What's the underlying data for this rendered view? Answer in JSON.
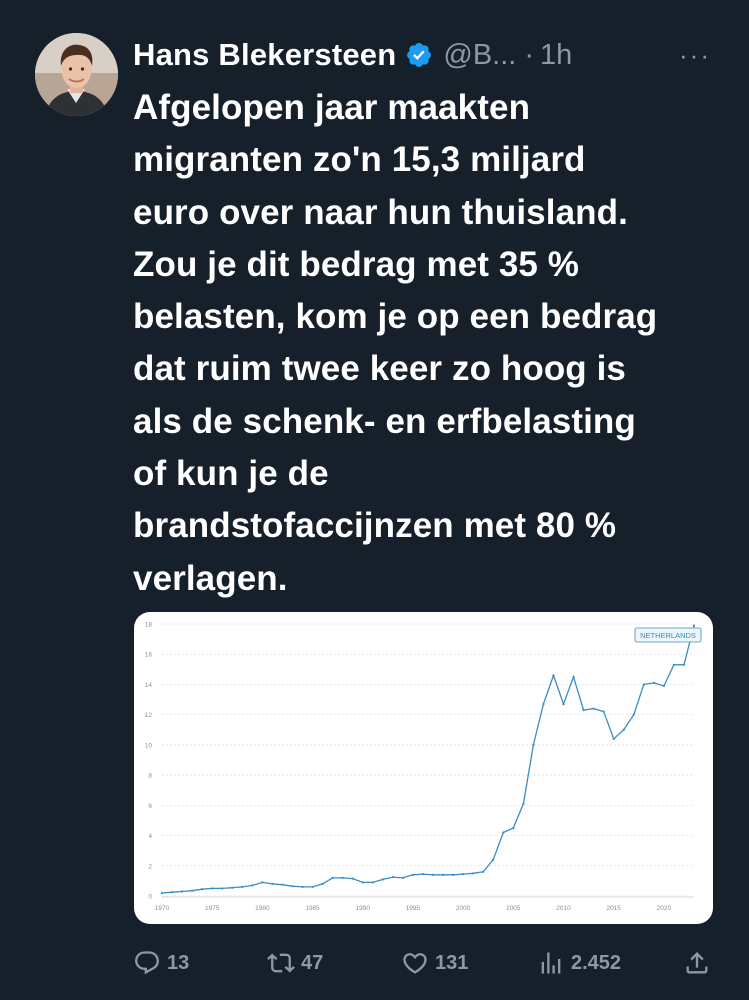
{
  "tweet": {
    "display_name": "Hans Blekersteen",
    "handle": "@B...",
    "separator": "·",
    "time": "1h",
    "more_glyph": "···",
    "text": "Afgelopen jaar maakten\nmigranten zo'n 15,3 miljard\neuro over naar hun thuisland.\nZou je dit bedrag met 35 %\nbelasten, kom je op een bedrag\ndat ruim twee keer zo hoog is\nals de schenk- en erfbelasting\nof kun je de\nbrandstofaccijnzen met 80 %\nverlagen."
  },
  "actions": {
    "replies": "13",
    "retweets": "47",
    "likes": "131",
    "views": "2.452"
  },
  "icons": {
    "reply": "speech-bubble",
    "retweet": "retweet-arrows",
    "like": "heart",
    "views": "bar-chart",
    "share": "share-upload",
    "verified": "verified-badge"
  },
  "colors": {
    "background": "#15202b",
    "secondary_text": "#8b98a5",
    "verified_blue": "#1d9bf0",
    "line": "#3a8dc4"
  },
  "chart_data": {
    "type": "line",
    "legend": "NETHERLANDS",
    "legend_position": "top-right",
    "grid": true,
    "xlim": [
      1970,
      2023
    ],
    "ylim": [
      0,
      18
    ],
    "x_ticks": [
      "1970",
      "1975",
      "1980",
      "1985",
      "1990",
      "1995",
      "2000",
      "2005",
      "2010",
      "2015",
      "2020"
    ],
    "y_ticks": [
      "0",
      "2",
      "4",
      "6",
      "8",
      "10",
      "12",
      "14",
      "16",
      "18"
    ],
    "series": [
      {
        "name": "NETHERLANDS",
        "x": [
          1970,
          1971,
          1972,
          1973,
          1974,
          1975,
          1976,
          1977,
          1978,
          1979,
          1980,
          1981,
          1982,
          1983,
          1984,
          1985,
          1986,
          1987,
          1988,
          1989,
          1990,
          1991,
          1992,
          1993,
          1994,
          1995,
          1996,
          1997,
          1998,
          1999,
          2000,
          2001,
          2002,
          2003,
          2004,
          2005,
          2006,
          2007,
          2008,
          2009,
          2010,
          2011,
          2012,
          2013,
          2014,
          2015,
          2016,
          2017,
          2018,
          2019,
          2020,
          2021,
          2022,
          2023
        ],
        "y": [
          0.2,
          0.25,
          0.3,
          0.35,
          0.45,
          0.5,
          0.5,
          0.55,
          0.6,
          0.7,
          0.9,
          0.8,
          0.75,
          0.65,
          0.6,
          0.6,
          0.8,
          1.2,
          1.2,
          1.15,
          0.9,
          0.9,
          1.1,
          1.25,
          1.2,
          1.4,
          1.45,
          1.4,
          1.4,
          1.4,
          1.45,
          1.5,
          1.6,
          2.4,
          4.2,
          4.5,
          6.1,
          10.0,
          12.7,
          14.6,
          12.7,
          14.5,
          12.3,
          12.4,
          12.2,
          10.4,
          11.0,
          12.0,
          14.0,
          14.1,
          13.9,
          15.3,
          15.3,
          17.9
        ]
      }
    ]
  }
}
